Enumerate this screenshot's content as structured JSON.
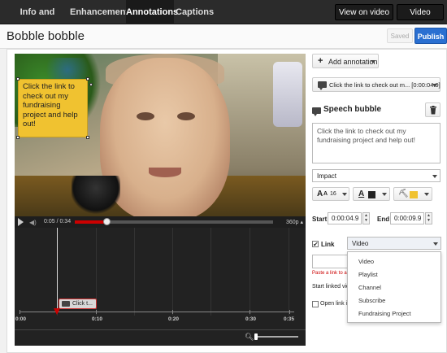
{
  "nav": {
    "tabs": [
      {
        "label": "Info and Settings"
      },
      {
        "label": "Enhancements"
      },
      {
        "label": "Annotations"
      },
      {
        "label": "Captions"
      }
    ],
    "view_on_video_page": "View on video page",
    "video_manager": "Video Manager"
  },
  "title_bar": {
    "title": "Bobble bobble",
    "saved_label": "Saved",
    "publish_label": "Publish"
  },
  "video": {
    "annotation_text": "Click the link to check out my fundraising project and help out!",
    "time": "0:05 / 0:34",
    "quality": "360p",
    "progress": 0.16
  },
  "timeline": {
    "clip_label": "Click t...",
    "labels": [
      "0:00",
      "0:10",
      "0:20",
      "0:30",
      "0:35"
    ]
  },
  "panel": {
    "add_annotation": "Add annotation",
    "annotation_select": "Click the link to check out m... [0:00:04.9]",
    "type_label": "Speech bubble",
    "text": "Click the link to check out my fundraising project and help out!",
    "font": "Impact",
    "font_size": "16",
    "text_color": "#222222",
    "bg_color": "#f0c230",
    "start_label": "Start",
    "start_time": "0:00:04.9",
    "end_label": "End",
    "end_time": "0:00:09.9",
    "link_label": "Link",
    "link_checked": "✔",
    "link_type": "Video",
    "link_error": "Paste a link to a",
    "start_linked": "Start linked vid",
    "open_link": "Open link i",
    "link_options": [
      "Video",
      "Playlist",
      "Channel",
      "Subscribe",
      "Fundraising Project"
    ]
  }
}
